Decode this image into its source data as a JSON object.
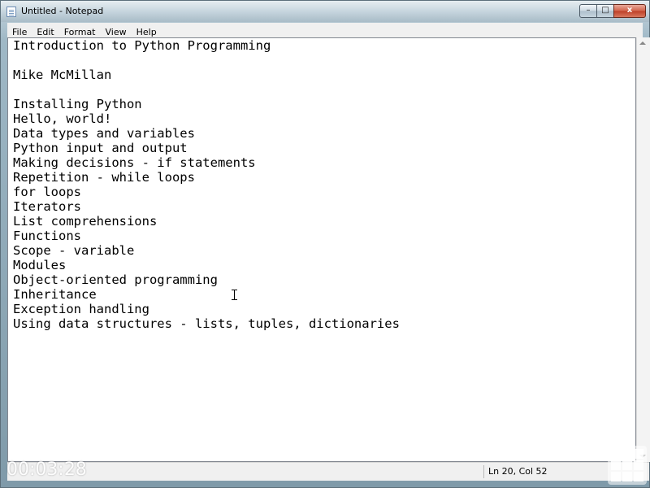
{
  "window": {
    "title": "Untitled - Notepad",
    "controls": {
      "minimize": "–",
      "maximize": "□",
      "close": "x"
    }
  },
  "menu": {
    "items": [
      {
        "label": "File"
      },
      {
        "label": "Edit"
      },
      {
        "label": "Format"
      },
      {
        "label": "View"
      },
      {
        "label": "Help"
      }
    ]
  },
  "editor": {
    "lines": [
      "Introduction to Python Programming",
      "",
      "Mike McMillan",
      "",
      "Installing Python",
      "Hello, world!",
      "Data types and variables",
      "Python input and output",
      "Making decisions - if statements",
      "Repetition - while loops",
      "for loops",
      "Iterators",
      "List comprehensions",
      "Functions",
      "Scope - variable",
      "Modules",
      "Object-oriented programming",
      "Inheritance",
      "Exception handling",
      "Using data structures - lists, tuples, dictionaries"
    ]
  },
  "status": {
    "position": "Ln 20, Col 52"
  },
  "overlay": {
    "timestamp": "00:03:28"
  },
  "icons": {
    "app": "notepad-icon",
    "cursor": "text-cursor-icon",
    "grip": "grid-grip-icon"
  }
}
